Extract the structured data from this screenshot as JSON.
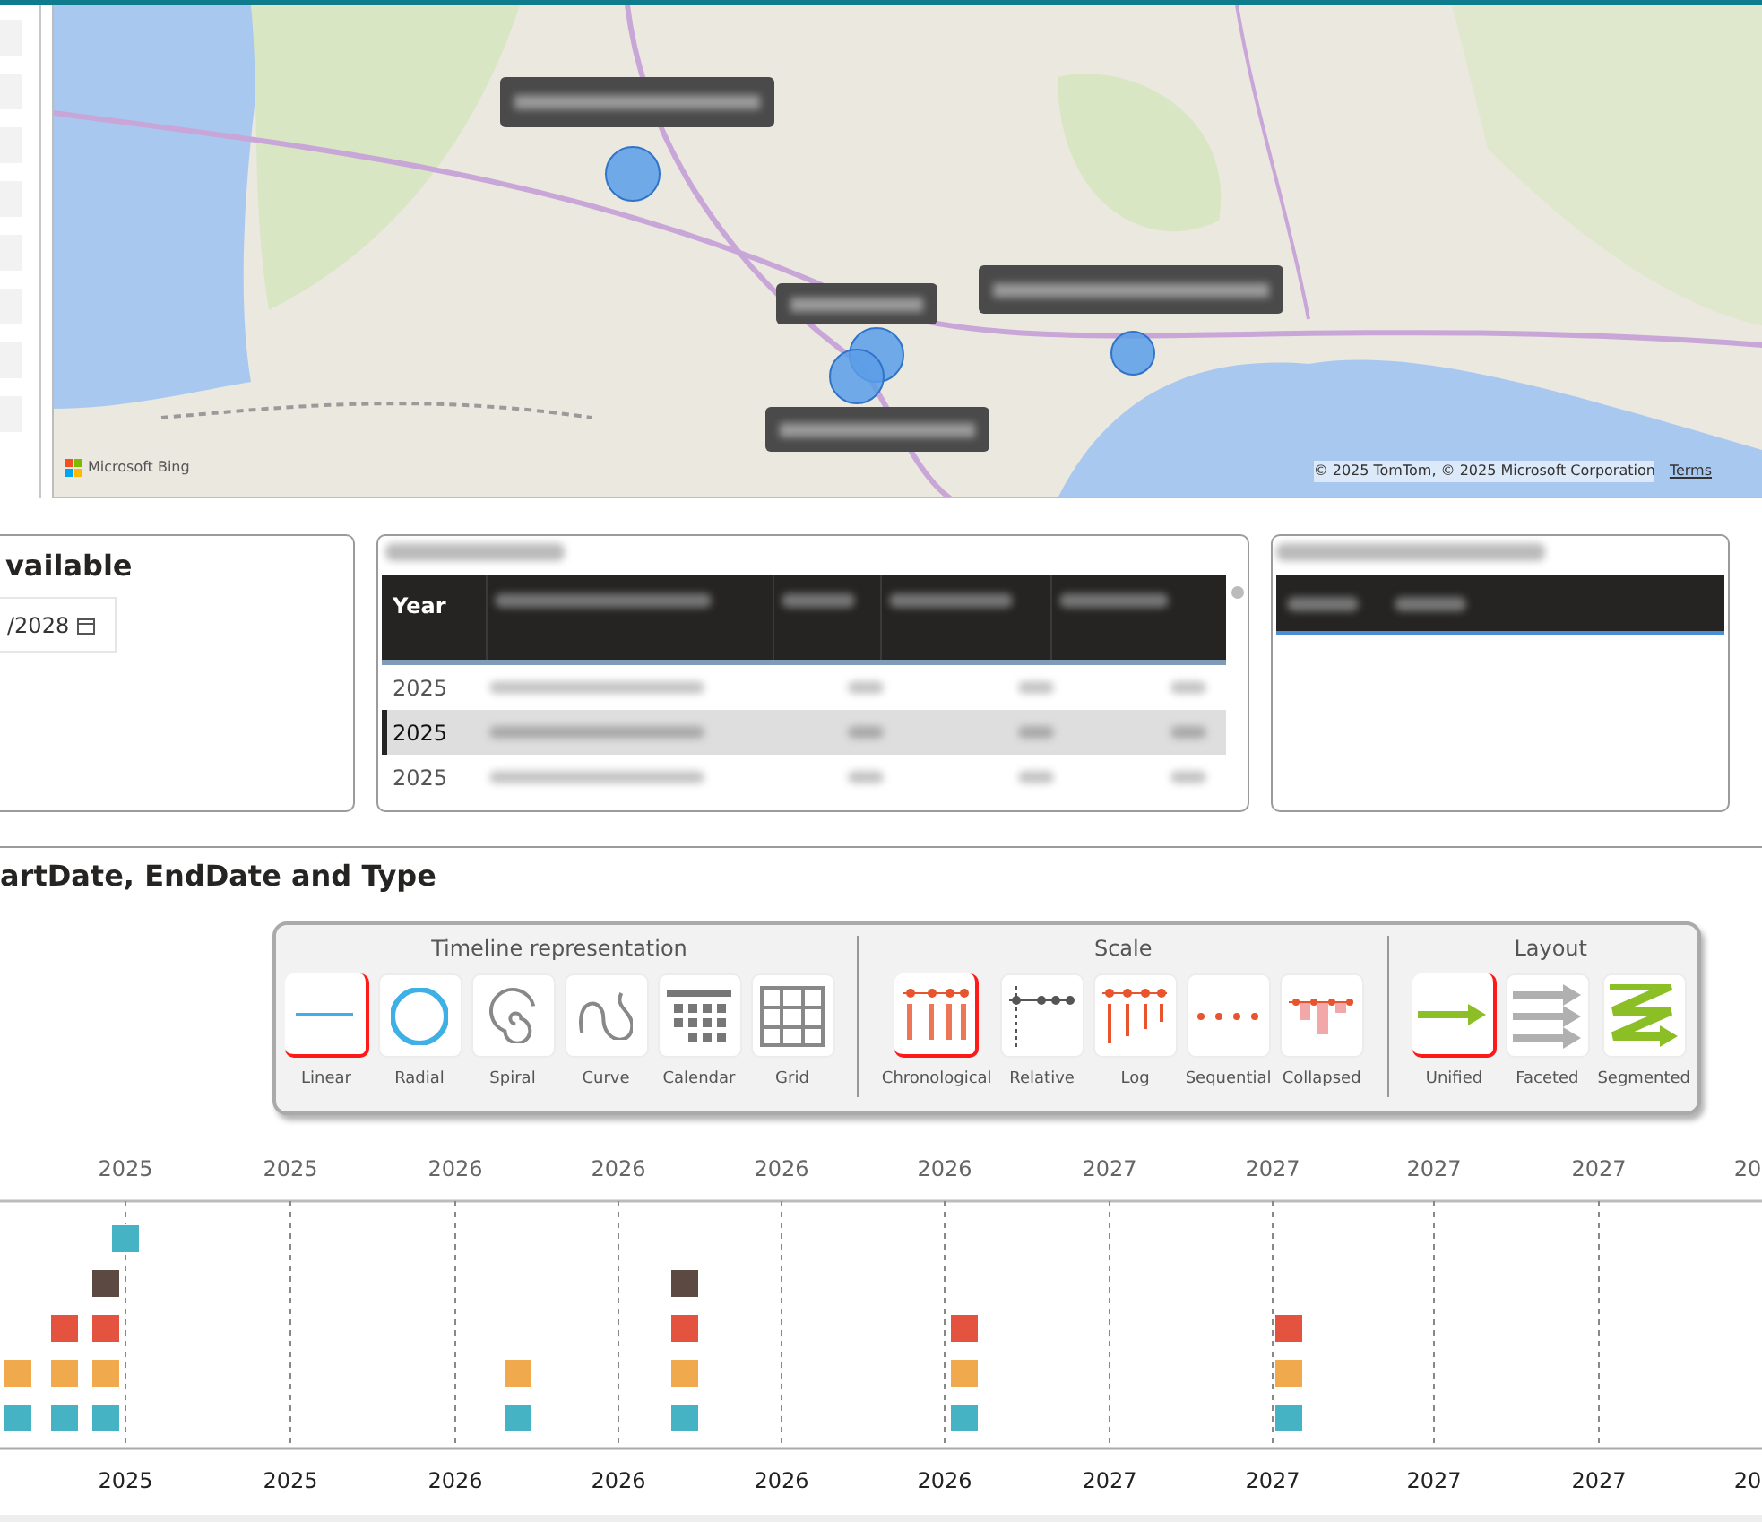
{
  "map": {
    "attribution": "© 2025 TomTom, © 2025 Microsoft Corporation",
    "terms_link": "Terms",
    "provider": "Microsoft Bing"
  },
  "date_card": {
    "title": "vailable",
    "date_value": "/2028"
  },
  "table": {
    "columns": [
      "Year"
    ],
    "rows": [
      {
        "year": "2025",
        "selected": false
      },
      {
        "year": "2025",
        "selected": true
      },
      {
        "year": "2025",
        "selected": false
      }
    ]
  },
  "timeline_title": "artDate, EndDate and Type",
  "toolbar": [
    {
      "title": "Timeline representation",
      "options": [
        {
          "label": "Linear",
          "selected": true
        },
        {
          "label": "Radial",
          "selected": false
        },
        {
          "label": "Spiral",
          "selected": false
        },
        {
          "label": "Curve",
          "selected": false
        },
        {
          "label": "Calendar",
          "selected": false
        },
        {
          "label": "Grid",
          "selected": false
        }
      ]
    },
    {
      "title": "Scale",
      "options": [
        {
          "label": "Chronological",
          "selected": true
        },
        {
          "label": "Relative",
          "selected": false
        },
        {
          "label": "Log",
          "selected": false
        },
        {
          "label": "Sequential",
          "selected": false
        },
        {
          "label": "Collapsed",
          "selected": false
        }
      ]
    },
    {
      "title": "Layout",
      "options": [
        {
          "label": "Unified",
          "selected": true
        },
        {
          "label": "Faceted",
          "selected": false
        },
        {
          "label": "Segmented",
          "selected": false
        }
      ]
    }
  ],
  "top_axis": [
    "2025",
    "2025",
    "2026",
    "2026",
    "2026",
    "2026",
    "2027",
    "2027",
    "2027",
    "2027",
    "20"
  ],
  "bottom_axis": [
    "2025",
    "2025",
    "2026",
    "2026",
    "2026",
    "2026",
    "2027",
    "2027",
    "2027",
    "2027",
    "20"
  ],
  "event_columns": [
    {
      "markers": [
        {
          "color": "#45b3c3"
        },
        {
          "color": "#f0a94c"
        }
      ]
    },
    {
      "markers": [
        {
          "color": "#45b3c3"
        },
        {
          "color": "#f0a94c"
        },
        {
          "color": "#e4533f"
        }
      ]
    },
    {
      "markers": [
        {
          "color": "#45b3c3"
        },
        {
          "color": "#f0a94c"
        },
        {
          "color": "#e4533f"
        },
        {
          "color": "#5c4a42"
        }
      ]
    },
    {
      "markers": [
        {
          "color": "#45b3c3"
        }
      ]
    },
    {
      "markers": [
        {
          "color": "#45b3c3"
        },
        {
          "color": "#f0a94c"
        }
      ]
    },
    {
      "markers": [
        {
          "color": "#45b3c3"
        },
        {
          "color": "#f0a94c"
        },
        {
          "color": "#e4533f"
        },
        {
          "color": "#5c4a42"
        }
      ]
    },
    {
      "markers": [
        {
          "color": "#45b3c3"
        },
        {
          "color": "#f0a94c"
        },
        {
          "color": "#e4533f"
        }
      ]
    },
    {
      "markers": [
        {
          "color": "#45b3c3"
        },
        {
          "color": "#f0a94c"
        },
        {
          "color": "#e4533f"
        }
      ]
    }
  ]
}
